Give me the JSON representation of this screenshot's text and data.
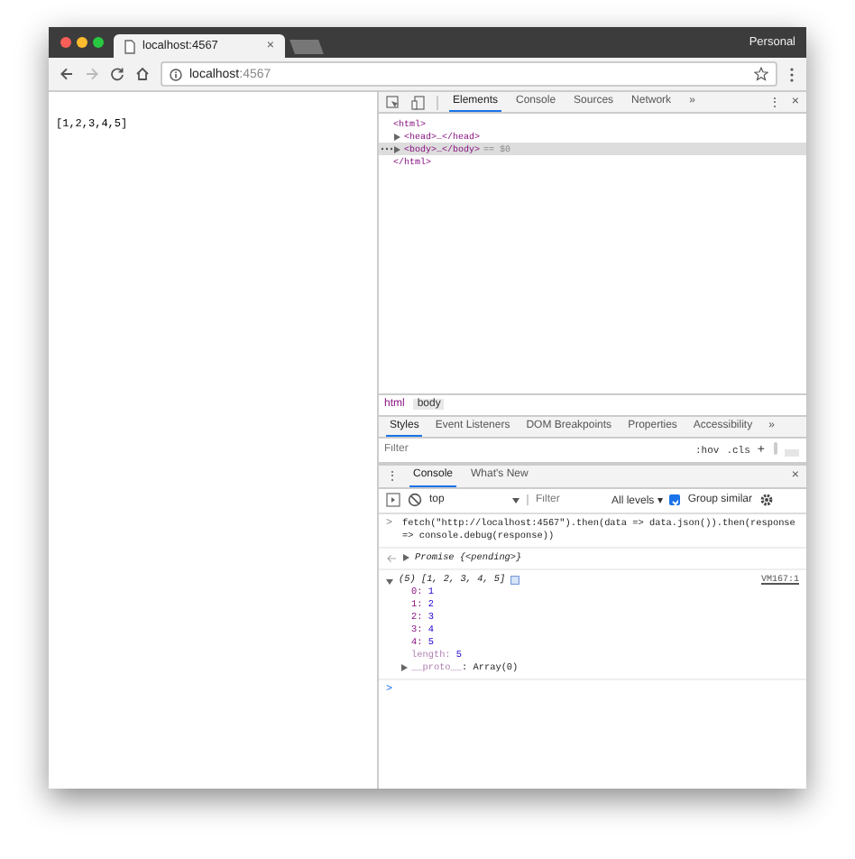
{
  "window": {
    "profile": "Personal",
    "tabs": [
      {
        "title": "localhost:4567",
        "close": "×",
        "selected": true
      },
      {
        "selected": false
      }
    ]
  },
  "address": {
    "host": "localhost",
    "port": ":4567"
  },
  "page": {
    "text": "[1,2,3,4,5]"
  },
  "devtools": {
    "tabs": [
      {
        "label": "Elements",
        "selected": true
      },
      {
        "label": "Console",
        "selected": false
      },
      {
        "label": "Sources",
        "selected": false
      },
      {
        "label": "Network",
        "selected": false
      }
    ],
    "overflow": "»",
    "menu": "⋮",
    "close": "×",
    "dom_tree": [
      {
        "open": "<html>",
        "close": "</html>",
        "selected": false,
        "children": [
          {
            "text": "<head>…</head>",
            "expanded": false,
            "selected": false
          },
          {
            "text": "<body>…</body>",
            "suffix": "== $0",
            "expanded": false,
            "selected": true
          }
        ]
      }
    ],
    "breadcrumbs": [
      {
        "label": "html",
        "selected": false
      },
      {
        "label": "body",
        "selected": true
      }
    ],
    "styles_tabs": [
      {
        "label": "Styles",
        "selected": true
      },
      {
        "label": "Event Listeners",
        "selected": false
      },
      {
        "label": "DOM Breakpoints",
        "selected": false
      },
      {
        "label": "Properties",
        "selected": false
      },
      {
        "label": "Accessibility",
        "selected": false
      }
    ],
    "styles_overflow": "»",
    "styles_filter": {
      "placeholder": "Filter",
      "hov": ":hov",
      "cls": ".cls",
      "add": "+"
    },
    "drawer_tabs": [
      {
        "label": "Console",
        "selected": true
      },
      {
        "label": "What's New",
        "selected": false
      }
    ],
    "drawer_menu": "⋮",
    "drawer_close": "×",
    "console_toolbar": {
      "context": "top",
      "filter_placeholder": "Filter",
      "levels": "All levels ▾",
      "group_similar": {
        "label": "Group similar",
        "checked": true
      }
    },
    "console": [
      {
        "kind": "input",
        "prompt": ">",
        "text": "fetch(\"http://localhost:4567\").then(data => data.json()).then(response => console.debug(response))"
      },
      {
        "kind": "result",
        "text": "Promise {<pending>}"
      },
      {
        "kind": "object",
        "summary": "(5) [1, 2, 3, 4, 5]",
        "source": "VM167:1",
        "expanded": true,
        "properties": [
          {
            "key": "0:",
            "value": "1"
          },
          {
            "key": "1:",
            "value": "2"
          },
          {
            "key": "2:",
            "value": "3"
          },
          {
            "key": "3:",
            "value": "4"
          },
          {
            "key": "4:",
            "value": "5"
          },
          {
            "key": "length:",
            "value": "5",
            "dim": true
          }
        ],
        "proto": "__proto__",
        "proto_value": ": Array(0)"
      },
      {
        "kind": "prompt",
        "prompt": ">"
      }
    ]
  }
}
